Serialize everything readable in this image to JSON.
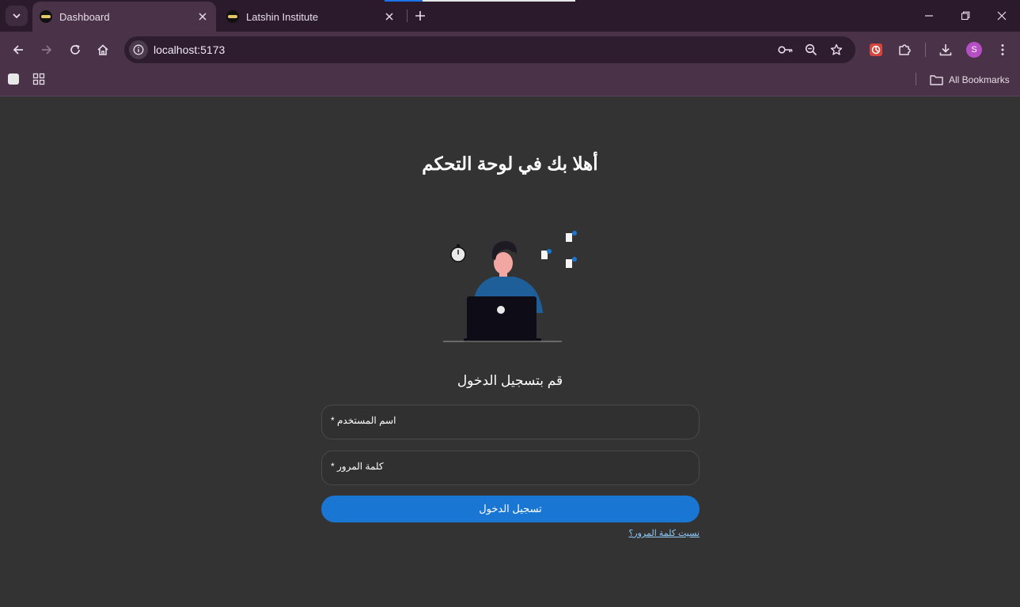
{
  "browser": {
    "tabs": [
      {
        "title": "Dashboard",
        "active": true
      },
      {
        "title": "Latshin Institute",
        "active": false
      }
    ],
    "address": "localhost:5173",
    "profile_initial": "S",
    "bookmarks_label": "All Bookmarks",
    "accent_color": "#4a3248"
  },
  "login": {
    "welcome_title": "أهلا بك في لوحة التحكم",
    "subtitle": "قم بتسجيل الدخول",
    "username_label": "اسم المستخدم *",
    "password_label": "كلمة المرور *",
    "submit_label": "تسجيل الدخول",
    "forgot_link": "نسيت كلمة المرور؟",
    "button_color": "#1976d2",
    "link_color": "#90caf9"
  }
}
